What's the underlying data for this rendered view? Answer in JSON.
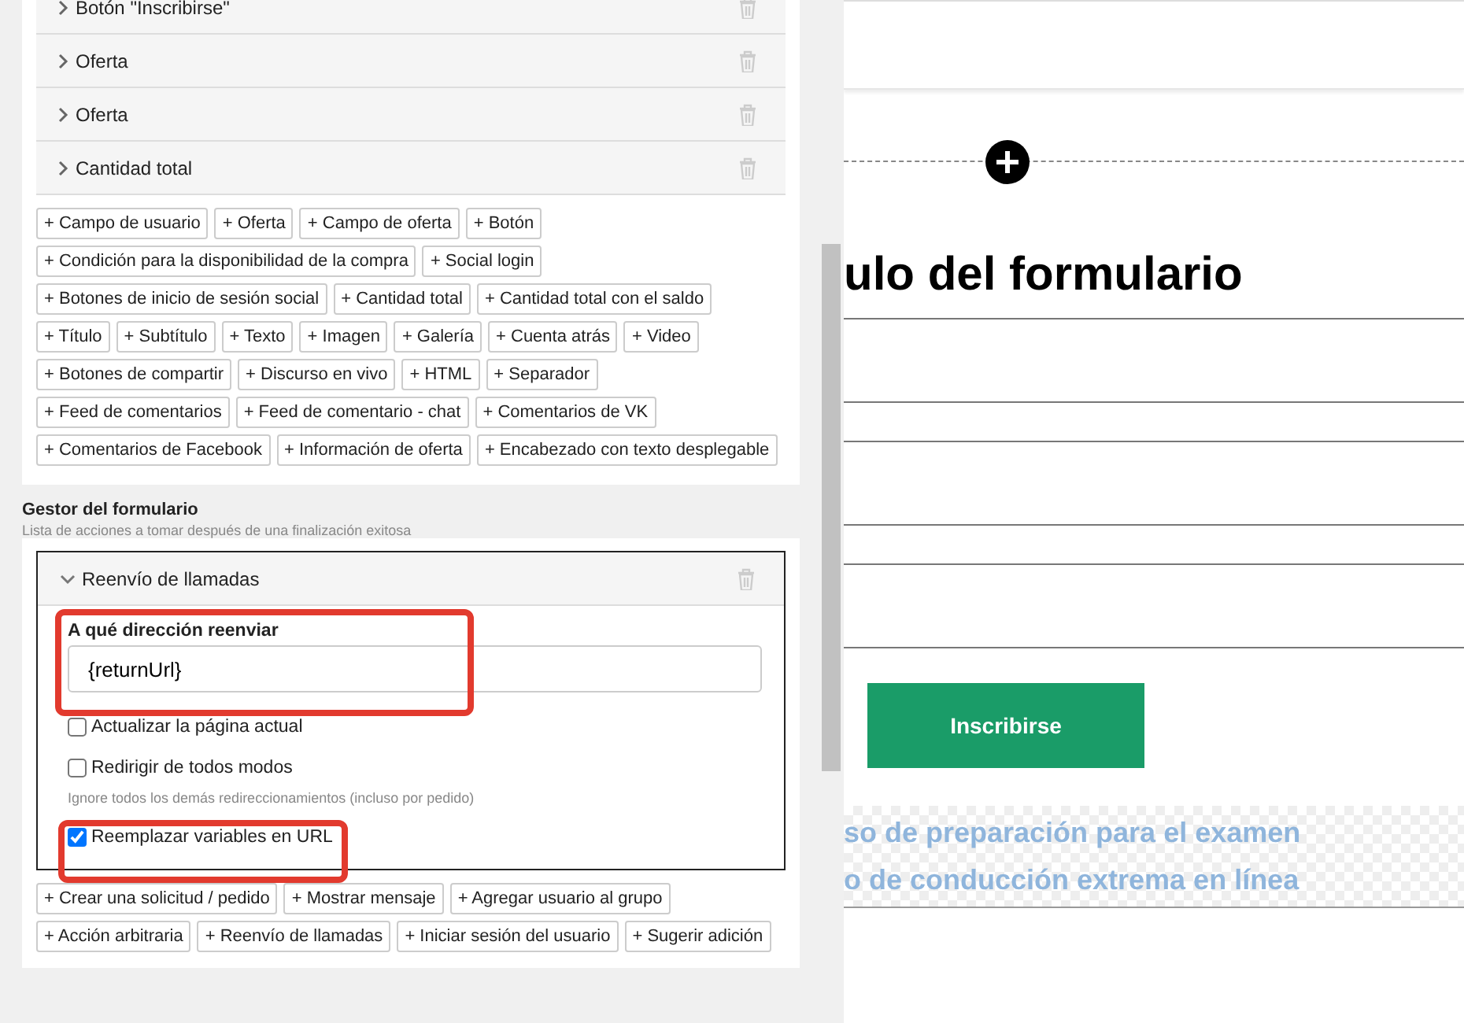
{
  "elements": [
    {
      "label": "Botón \"Inscribirse\"",
      "expanded": false
    },
    {
      "label": "Oferta",
      "expanded": false
    },
    {
      "label": "Oferta",
      "expanded": false
    },
    {
      "label": "Cantidad total",
      "expanded": false
    }
  ],
  "add_element_buttons": [
    [
      "+ Campo de usuario",
      "+ Oferta",
      "+ Campo de oferta",
      "+ Botón"
    ],
    [
      "+ Condición para la disponibilidad de la compra",
      "+ Social login"
    ],
    [
      "+ Botones de inicio de sesión social",
      "+ Cantidad total",
      "+ Cantidad total con el saldo"
    ],
    [
      "+ Título",
      "+ Subtítulo",
      "+ Texto",
      "+ Imagen",
      "+ Galería",
      "+ Cuenta atrás",
      "+ Video"
    ],
    [
      "+ Botones de compartir",
      "+ Discurso en vivo",
      "+ HTML",
      "+ Separador"
    ],
    [
      "+ Feed de comentarios",
      "+ Feed de comentario - chat",
      "+ Comentarios de VK"
    ],
    [
      "+ Comentarios de Facebook",
      "+ Información de oferta",
      "+ Encabezado con texto desplegable"
    ]
  ],
  "form_handler": {
    "title": "Gestor del formulario",
    "subtitle": "Lista de acciones a tomar después de una finalización exitosa",
    "action": {
      "label": "Reenvío de llamadas",
      "expanded": true,
      "address": {
        "label": "A qué dirección reenviar",
        "value": "{returnUrl}",
        "highlighted": true
      },
      "options": [
        {
          "label": "Actualizar la página actual",
          "checked": false
        },
        {
          "label": "Redirigir de todos modos",
          "checked": false,
          "hint": "Ignore todos los demás redireccionamientos (incluso por pedido)"
        },
        {
          "label": "Reemplazar variables en URL",
          "checked": true,
          "highlighted": true
        }
      ]
    },
    "add_action_buttons": [
      [
        "+ Crear una solicitud / pedido",
        "+ Mostrar mensaje",
        "+ Agregar usuario al grupo"
      ],
      [
        "+ Acción arbitraria",
        "+ Reenvío de llamadas",
        "+ Iniciar sesión del usuario",
        "+ Sugerir adición"
      ]
    ]
  },
  "preview": {
    "heading": "ulo del formulario",
    "submit": "Inscribirse",
    "offer_lines": [
      "so de preparación para el examen",
      "o de conducción extrema en línea"
    ]
  }
}
